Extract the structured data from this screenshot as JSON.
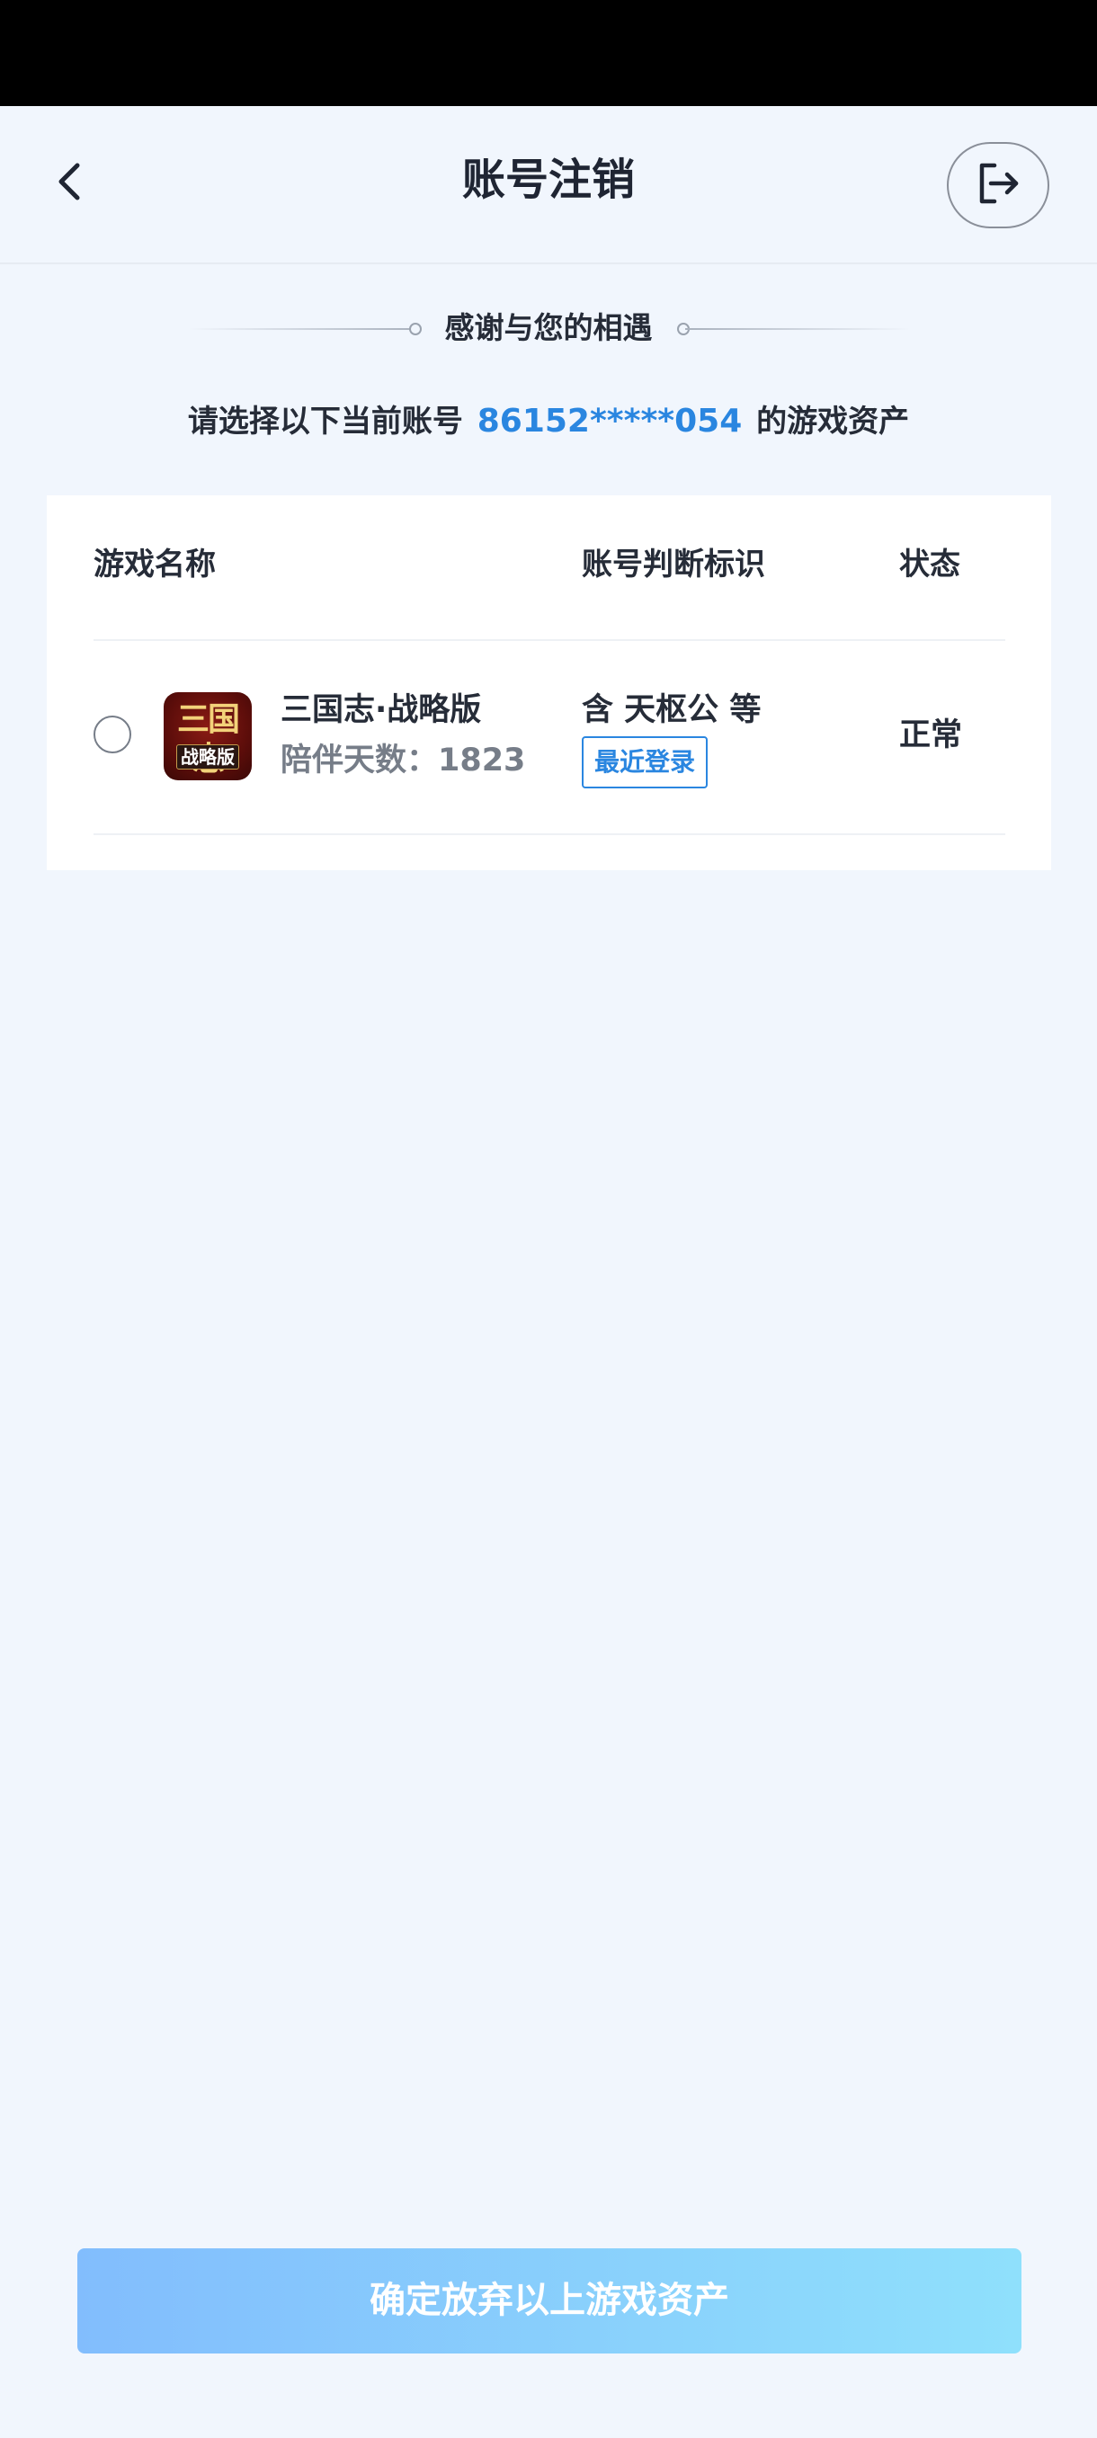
{
  "header": {
    "title": "账号注销",
    "back_icon": "chevron-left-icon",
    "logout_icon": "logout-icon"
  },
  "intro": {
    "thanks": "感谢与您的相遇",
    "subtitle_prefix": "请选择以下当前账号",
    "account": "86152*****054",
    "subtitle_suffix": "的游戏资产"
  },
  "table": {
    "headers": {
      "name": "游戏名称",
      "mark": "账号判断标识",
      "status": "状态"
    },
    "rows": [
      {
        "selected": false,
        "icon": {
          "top_text": "三国志",
          "bottom_text": "战略版"
        },
        "name": "三国志·战略版",
        "days": "陪伴天数：1823",
        "mark": "含 天枢公 等",
        "badge": "最近登录",
        "status": "正常"
      }
    ]
  },
  "footer": {
    "confirm_label": "确定放弃以上游戏资产"
  },
  "colors": {
    "accent": "#2a86e0",
    "background": "#f1f6fd",
    "button_gradient_start": "#82bdfd",
    "button_gradient_end": "#8fe0fc"
  }
}
